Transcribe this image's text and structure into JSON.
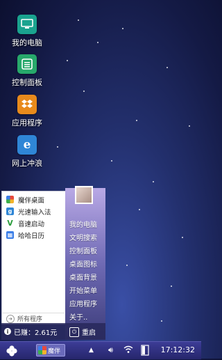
{
  "desktop": {
    "icons": [
      {
        "label": "我的电脑",
        "icon": "computer-icon",
        "color": "#1aa38f"
      },
      {
        "label": "控制面板",
        "icon": "control-panel-icon",
        "color": "#27a86b"
      },
      {
        "label": "应用程序",
        "icon": "dropbox-icon",
        "color": "#e88a1c"
      },
      {
        "label": "网上冲浪",
        "icon": "ie-browser-icon",
        "color": "#2f86d6"
      }
    ]
  },
  "start_menu": {
    "programs": [
      {
        "label": "魔伴桌面",
        "icon": "pinwheel-icon"
      },
      {
        "label": "光速输入法",
        "icon": "input-method-icon"
      },
      {
        "label": "音速启动",
        "icon": "quick-launch-icon"
      },
      {
        "label": "哈哈日历",
        "icon": "calendar-icon"
      }
    ],
    "all_programs": "所有程序",
    "right_items": [
      "我的电脑",
      "文明搜索",
      "控制面板",
      "桌面图标",
      "桌面背景",
      "开始菜单",
      "应用程序",
      "关于.."
    ],
    "earned": "已赚：2.61元",
    "restart": "重启"
  },
  "taskbar": {
    "app_label": "魔伴",
    "clock": "17:12:32"
  },
  "colors": {
    "taskbar": "#2e2e80",
    "menu_accent": "#6f6ab4"
  }
}
